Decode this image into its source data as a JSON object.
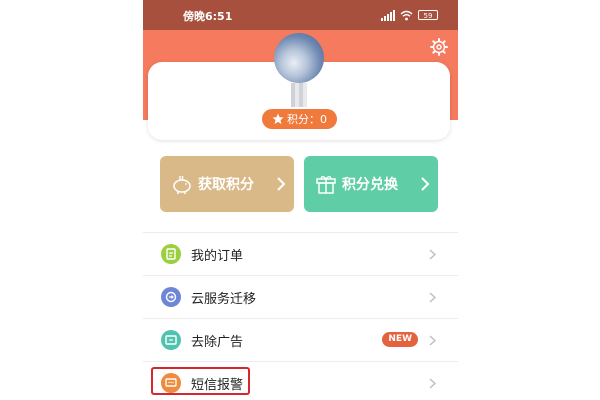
{
  "status_bar": {
    "time": "傍晚6:51",
    "battery": "59"
  },
  "profile": {
    "points_label": "积分：0"
  },
  "actions": {
    "get_points": "获取积分",
    "exchange_points": "积分兑换"
  },
  "menu": {
    "items": [
      {
        "label": "我的订单",
        "icon": "order-icon",
        "color": "#9ccf3f"
      },
      {
        "label": "云服务迁移",
        "icon": "cloud-migrate-icon",
        "color": "#6f86d6"
      },
      {
        "label": "去除广告",
        "icon": "remove-ads-icon",
        "color": "#4fc3b0",
        "badge": "NEW"
      },
      {
        "label": "短信报警",
        "icon": "sms-alert-icon",
        "color": "#f08a3c"
      }
    ]
  },
  "colors": {
    "status_bar": "#a8503e",
    "header": "#f57a5e",
    "points_badge": "#f07a3c",
    "get_points_button": "#d9b988",
    "exchange_button": "#5fcda6",
    "highlight": "#d8262e",
    "new_badge": "#e4623e"
  }
}
